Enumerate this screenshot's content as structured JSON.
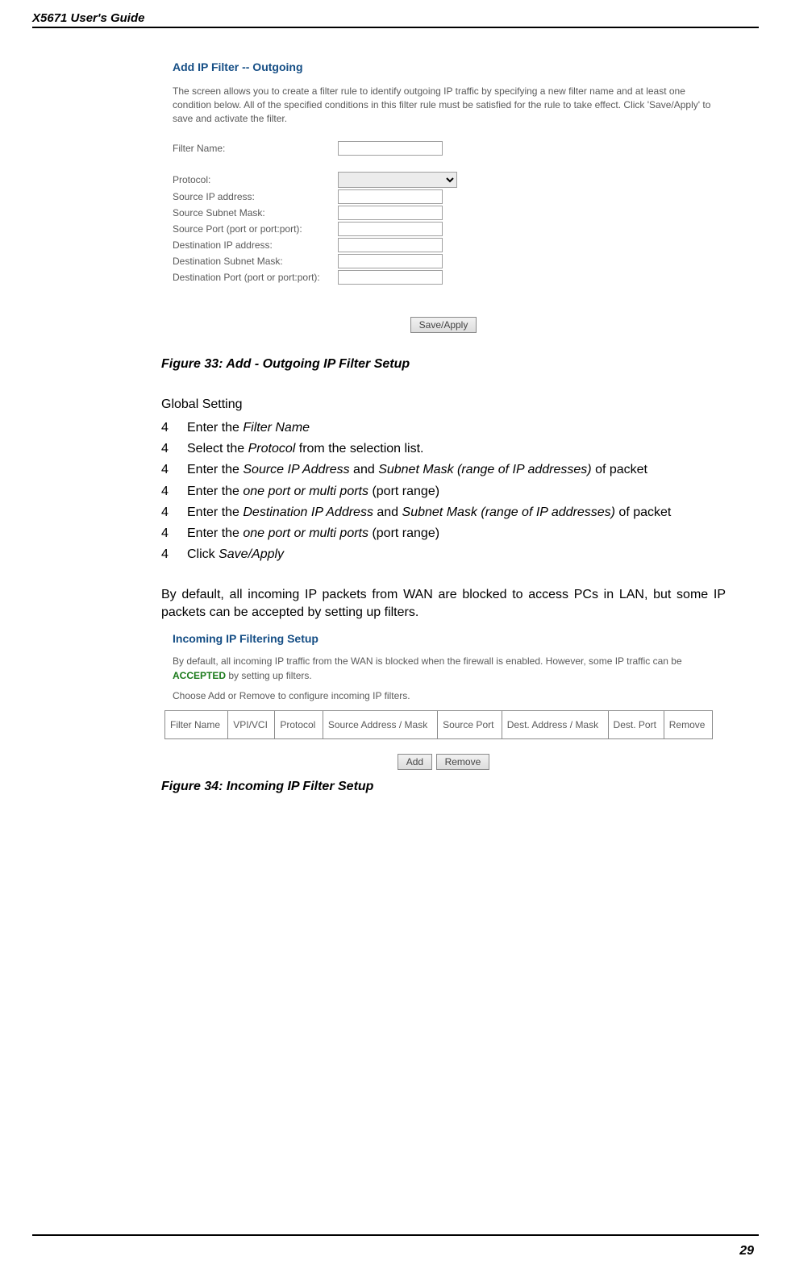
{
  "header": {
    "running_title": "X5671 User's Guide"
  },
  "page_number": "29",
  "shot1": {
    "title": "Add IP Filter -- Outgoing",
    "blurb": "The screen allows you to create a filter rule to identify outgoing IP traffic by specifying a new filter name and at least one condition below. All of the specified conditions in this filter rule must be satisfied for the rule to take effect. Click 'Save/Apply' to save and activate the filter.",
    "labels": {
      "filter_name": "Filter Name:",
      "protocol": "Protocol:",
      "src_ip": "Source IP address:",
      "src_mask": "Source Subnet Mask:",
      "src_port": "Source Port (port or port:port):",
      "dst_ip": "Destination IP address:",
      "dst_mask": "Destination Subnet Mask:",
      "dst_port": "Destination Port (port or port:port):"
    },
    "save_apply": "Save/Apply"
  },
  "caption1": "Figure 33: Add - Outgoing IP Filter Setup",
  "section_heading": "Global Setting",
  "steps": [
    {
      "n": "4",
      "pre": "Enter the ",
      "it": "Filter Name",
      "post": ""
    },
    {
      "n": "4",
      "pre": "Select the ",
      "it": "Protocol",
      "post": " from the selection list."
    },
    {
      "n": "4",
      "pre": "Enter the ",
      "it": "Source IP Address",
      "mid": " and ",
      "it2": "Subnet Mask (range of IP addresses)",
      "post": " of packet"
    },
    {
      "n": "4",
      "pre": "Enter the ",
      "it": "one port or multi ports",
      "post": " (port range)"
    },
    {
      "n": "4",
      "pre": "Enter the ",
      "it": "Destination IP Address",
      "mid": " and ",
      "it2": "Subnet Mask (range of IP addresses)",
      "post": " of packet"
    },
    {
      "n": "4",
      "pre": "Enter the ",
      "it": "one port or multi ports",
      "post": " (port range)"
    },
    {
      "n": "4",
      "pre": "Click ",
      "it": "Save/Apply",
      "post": ""
    }
  ],
  "para1": "By default, all incoming IP packets from WAN are blocked to access PCs in LAN, but some IP packets can be accepted by setting up filters.",
  "shot2": {
    "title": "Incoming IP Filtering Setup",
    "blurb_pre": "By default, all incoming IP traffic from the WAN is blocked when the firewall is enabled. However, some IP traffic can be ",
    "blurb_accepted": "ACCEPTED",
    "blurb_post": " by setting up filters.",
    "blurb2": "Choose Add or Remove to configure incoming IP filters.",
    "columns": [
      "Filter Name",
      "VPI/VCI",
      "Protocol",
      "Source Address / Mask",
      "Source Port",
      "Dest. Address / Mask",
      "Dest. Port",
      "Remove"
    ],
    "add": "Add",
    "remove": "Remove"
  },
  "caption2": "Figure 34: Incoming IP Filter Setup"
}
